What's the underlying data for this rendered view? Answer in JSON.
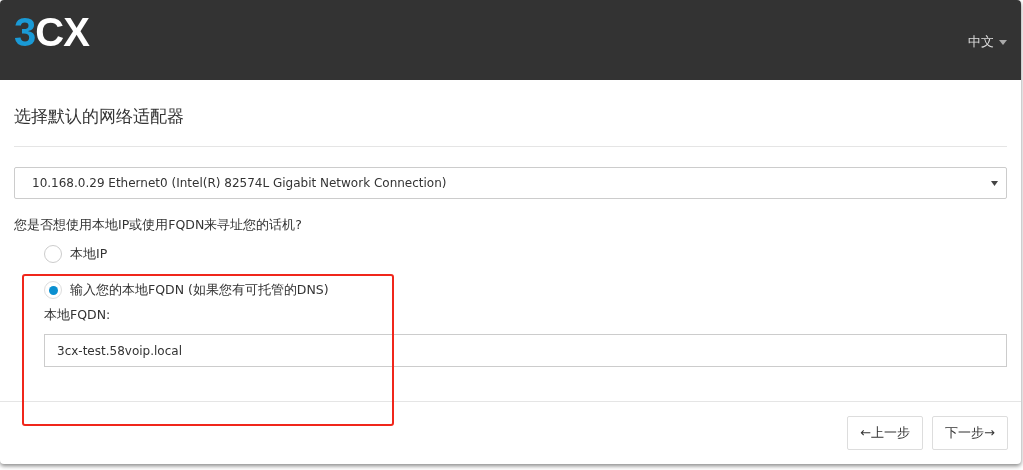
{
  "header": {
    "logo": {
      "accent": "3",
      "text": "CX"
    },
    "language": "中文"
  },
  "title": "选择默认的网络适配器",
  "adapter_select": {
    "value": "10.168.0.29 Ethernet0 (Intel(R) 82574L Gigabit Network Connection)"
  },
  "question": "您是否想使用本地IP或使用FQDN来寻址您的话机?",
  "options": [
    {
      "label": "本地IP",
      "selected": false
    },
    {
      "label": "输入您的本地FQDN (如果您有可托管的DNS)",
      "selected": true
    }
  ],
  "fqdn_field": {
    "label": "本地FQDN:",
    "value": "3cx-test.58voip.local"
  },
  "buttons": [
    {
      "label": "←上一步"
    },
    {
      "label": "下一步→"
    }
  ]
}
